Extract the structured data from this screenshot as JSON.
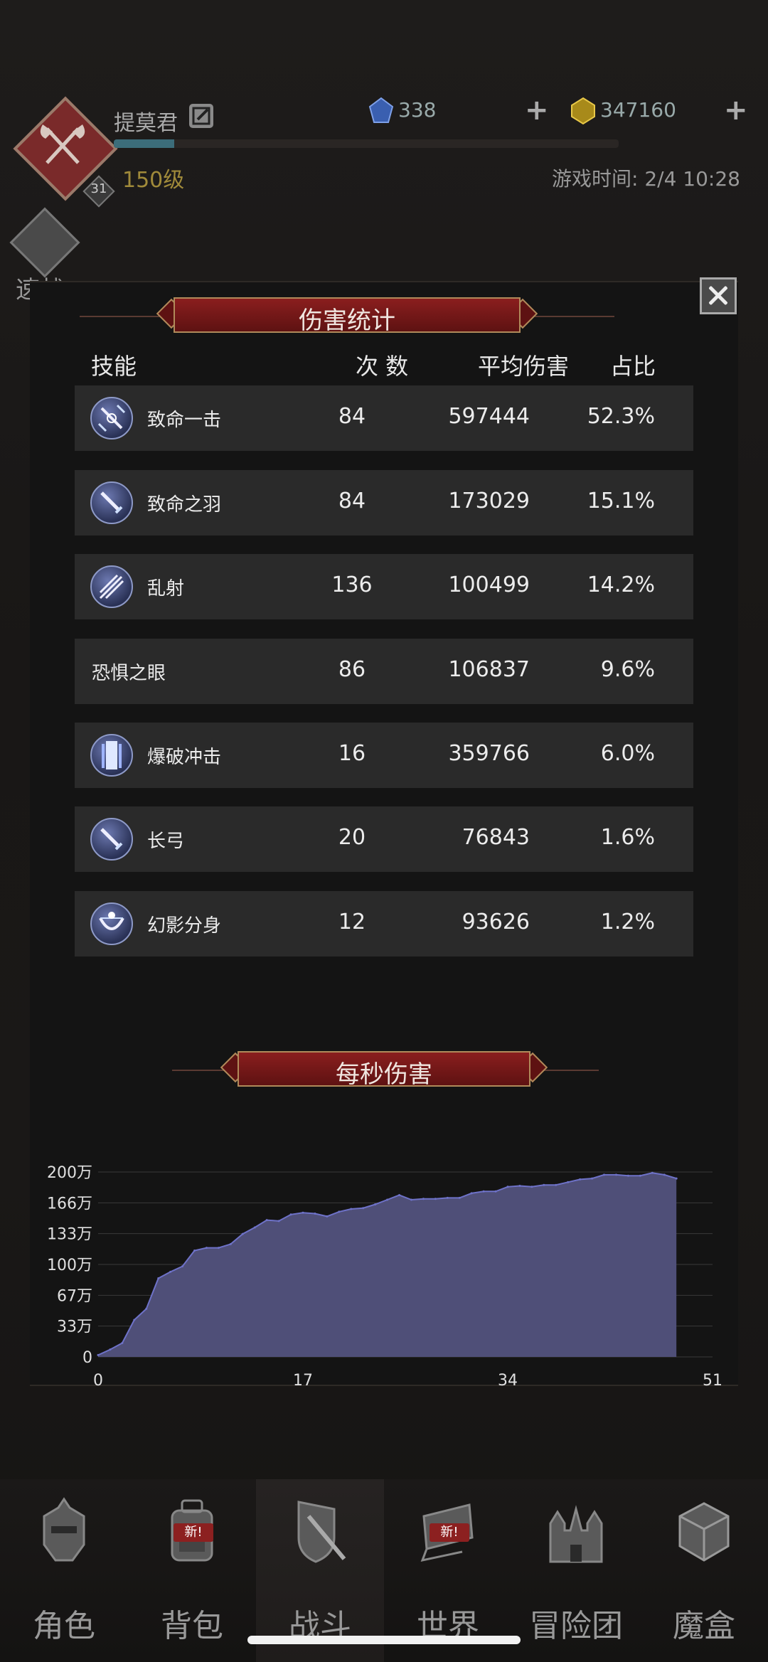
{
  "player": {
    "name": "提莫君",
    "level_text": "150级",
    "avatar_badge": "31",
    "exp_fraction": 0.12
  },
  "currency": {
    "diamond": "338",
    "gold": "347160"
  },
  "game_time": "游戏时间: 2/4 10:28",
  "quick_battle_label": "速战",
  "dialog": {
    "title": "伤害统计",
    "columns": {
      "skill": "技能",
      "count": "次 数",
      "avg": "平均伤害",
      "share": "占比"
    },
    "rows": [
      {
        "name": "致命一击",
        "count": "84",
        "avg": "597444",
        "share": "52.3%",
        "icon": "sword-burst-icon"
      },
      {
        "name": "致命之羽",
        "count": "84",
        "avg": "173029",
        "share": "15.1%",
        "icon": "sword-icon"
      },
      {
        "name": "乱射",
        "count": "136",
        "avg": "100499",
        "share": "14.2%",
        "icon": "arrow-volley-icon"
      },
      {
        "name": "恐惧之眼",
        "count": "86",
        "avg": "106837",
        "share": "9.6%",
        "icon": ""
      },
      {
        "name": "爆破冲击",
        "count": "16",
        "avg": "359766",
        "share": "6.0%",
        "icon": "light-pillar-icon"
      },
      {
        "name": "长弓",
        "count": "20",
        "avg": "76843",
        "share": "1.6%",
        "icon": "sword-icon"
      },
      {
        "name": "幻影分身",
        "count": "12",
        "avg": "93626",
        "share": "1.2%",
        "icon": "bow-icon"
      }
    ],
    "dps_title": "每秒伤害"
  },
  "chart_data": {
    "type": "area",
    "title": "每秒伤害",
    "xlabel": "",
    "ylabel": "",
    "x_ticks": [
      "0",
      "17",
      "34",
      "51"
    ],
    "y_ticks": [
      "0",
      "33万",
      "67万",
      "100万",
      "133万",
      "166万",
      "200万"
    ],
    "xlim": [
      0,
      51
    ],
    "ylim": [
      0,
      200
    ],
    "unit": "万",
    "x": [
      0,
      1,
      2,
      3,
      4,
      5,
      6,
      7,
      8,
      9,
      10,
      11,
      12,
      13,
      14,
      15,
      16,
      17,
      18,
      19,
      20,
      21,
      22,
      23,
      24,
      25,
      26,
      27,
      28,
      29,
      30,
      31,
      32,
      33,
      34,
      35,
      36,
      37,
      38,
      39,
      40,
      41,
      42,
      43,
      44,
      45,
      46,
      47,
      48
    ],
    "values": [
      2,
      8,
      15,
      40,
      52,
      85,
      92,
      98,
      115,
      118,
      118,
      122,
      133,
      140,
      148,
      147,
      154,
      156,
      155,
      152,
      157,
      160,
      161,
      165,
      170,
      175,
      170,
      171,
      171,
      172,
      172,
      177,
      179,
      179,
      184,
      185,
      184,
      186,
      186,
      189,
      192,
      193,
      197,
      197,
      196,
      196,
      199,
      197,
      193
    ],
    "series_color": "#4f4f78",
    "line_color": "#6e72c8",
    "grid": true
  },
  "nav": [
    {
      "label": "角色",
      "icon": "knight-helmet-icon",
      "new": ""
    },
    {
      "label": "背包",
      "icon": "backpack-icon",
      "new": "新!"
    },
    {
      "label": "战斗",
      "icon": "shield-sword-icon",
      "new": ""
    },
    {
      "label": "世界",
      "icon": "scroll-map-icon",
      "new": "新!"
    },
    {
      "label": "冒险团",
      "icon": "castle-icon",
      "new": ""
    },
    {
      "label": "魔盒",
      "icon": "magic-cube-icon",
      "new": ""
    }
  ]
}
